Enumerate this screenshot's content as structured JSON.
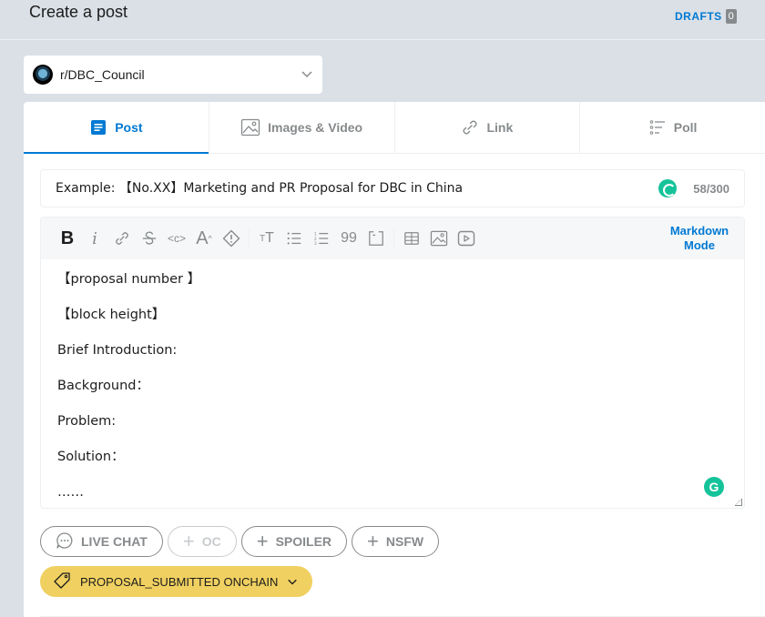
{
  "header": {
    "title": "Create a post",
    "drafts_label": "DRAFTS",
    "drafts_count": "0"
  },
  "community": {
    "name": "r/DBC_Council"
  },
  "tabs": [
    {
      "label": "Post",
      "icon": "post-icon",
      "active": true
    },
    {
      "label": "Images & Video",
      "icon": "image-icon",
      "active": false
    },
    {
      "label": "Link",
      "icon": "link-icon",
      "active": false
    },
    {
      "label": "Poll",
      "icon": "poll-icon",
      "active": false
    }
  ],
  "title_field": {
    "placeholder": "Example: 【No.XX】Marketing and PR Proposal for DBC in China",
    "char_count": "58/300"
  },
  "toolbar": {
    "tools": [
      "bold-icon",
      "italic-icon",
      "link-icon",
      "strikethrough-icon",
      "inline-code-icon",
      "superscript-icon",
      "spoiler-icon",
      "heading-icon",
      "bulleted-list-icon",
      "numbered-list-icon",
      "quote-block-icon",
      "code-block-icon",
      "table-icon",
      "image-icon",
      "video-icon"
    ],
    "markdown_mode_label": "Markdown Mode"
  },
  "body_lines": [
    "【proposal number 】",
    "【block height】",
    "Brief Introduction:",
    "Background：",
    "Problem:",
    "Solution：",
    "……"
  ],
  "flairs": [
    {
      "label": "LIVE CHAT",
      "icon": "chat-icon",
      "enabled": true
    },
    {
      "label": "OC",
      "icon": "plus-icon",
      "enabled": false
    },
    {
      "label": "SPOILER",
      "icon": "plus-icon",
      "enabled": true
    },
    {
      "label": "NSFW",
      "icon": "plus-icon",
      "enabled": true
    }
  ],
  "tag": {
    "label": "PROPOSAL_SUBMITTED ONCHAIN",
    "color": "#f0d060"
  },
  "colors": {
    "accent": "#0079d3",
    "background": "#dae0e6",
    "muted": "#878a8c",
    "grammarly": "#15c39a"
  }
}
